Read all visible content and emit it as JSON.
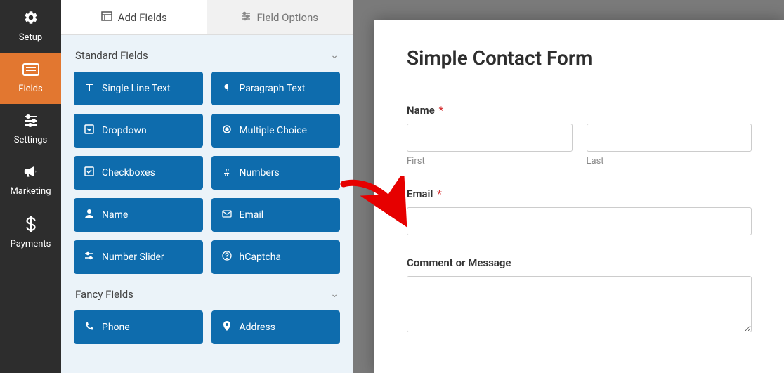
{
  "nav": {
    "setup": "Setup",
    "fields": "Fields",
    "settings": "Settings",
    "marketing": "Marketing",
    "payments": "Payments"
  },
  "tabs": {
    "add_fields": "Add Fields",
    "field_options": "Field Options"
  },
  "groups": {
    "standard": "Standard Fields",
    "fancy": "Fancy Fields"
  },
  "fields": {
    "single_line": "Single Line Text",
    "paragraph": "Paragraph Text",
    "dropdown": "Dropdown",
    "multiple_choice": "Multiple Choice",
    "checkboxes": "Checkboxes",
    "numbers": "Numbers",
    "name": "Name",
    "email": "Email",
    "number_slider": "Number Slider",
    "hcaptcha": "hCaptcha",
    "phone": "Phone",
    "address": "Address"
  },
  "form": {
    "title": "Simple Contact Form",
    "name_label": "Name",
    "first_sublabel": "First",
    "last_sublabel": "Last",
    "email_label": "Email",
    "comment_label": "Comment or Message",
    "required_mark": "*"
  }
}
